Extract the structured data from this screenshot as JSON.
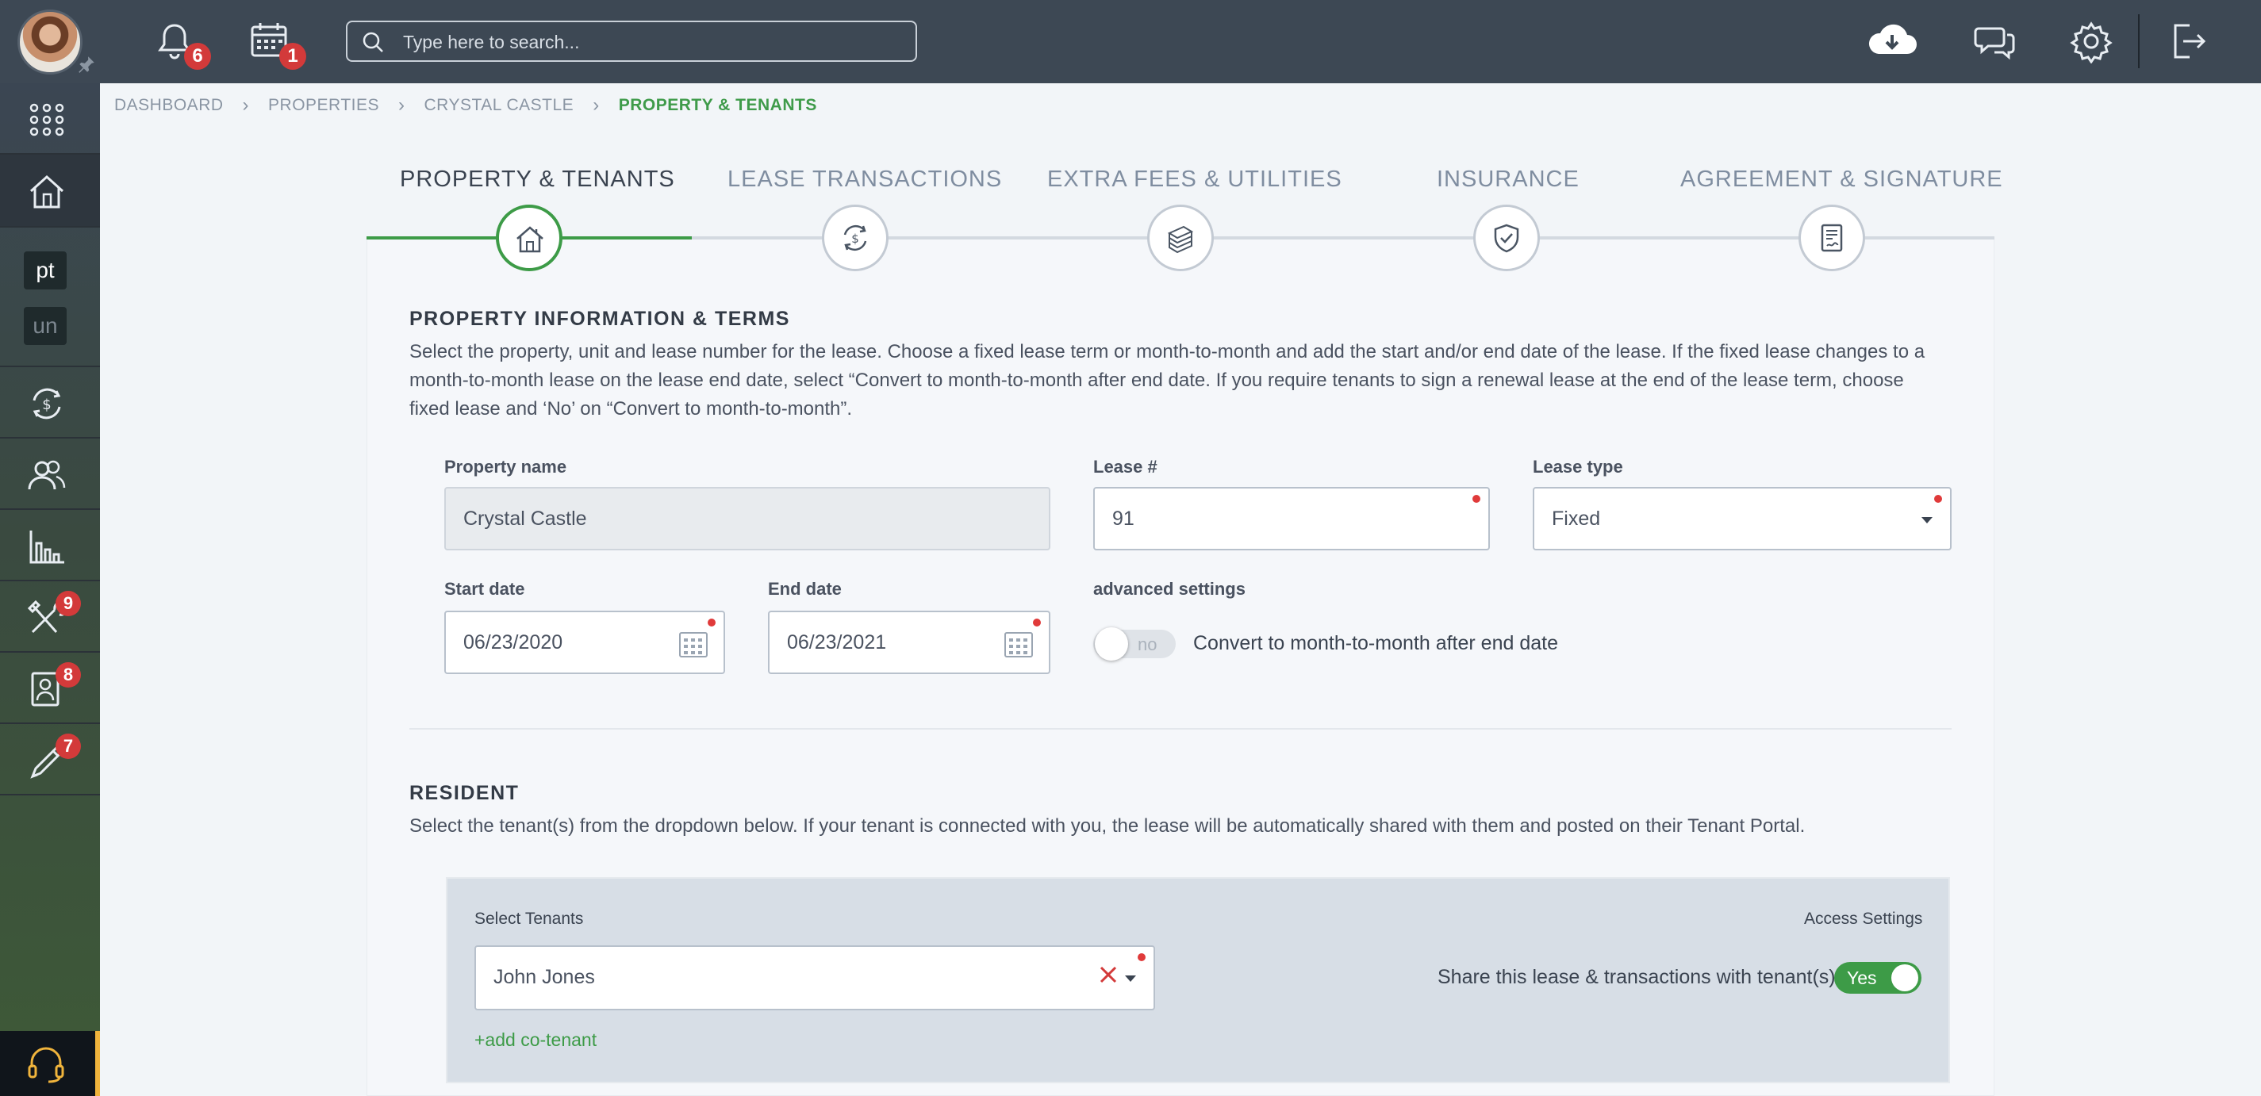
{
  "topbar": {
    "notifications_count": "6",
    "calendar_count": "1",
    "search_placeholder": "Type here to search..."
  },
  "sidebar": {
    "chip_pt": "pt",
    "chip_un": "un",
    "maintenance_badge": "9",
    "applicants_badge": "8",
    "tools_badge": "7"
  },
  "breadcrumb": {
    "items": [
      "DASHBOARD",
      "PROPERTIES",
      "CRYSTAL CASTLE"
    ],
    "current": "PROPERTY & TENANTS"
  },
  "stepper": {
    "steps": [
      {
        "label": "PROPERTY & TENANTS",
        "icon": "house-icon"
      },
      {
        "label": "LEASE TRANSACTIONS",
        "icon": "dollar-cycle-icon"
      },
      {
        "label": "EXTRA FEES & UTILITIES",
        "icon": "cash-stack-icon"
      },
      {
        "label": "INSURANCE",
        "icon": "shield-check-icon"
      },
      {
        "label": "AGREEMENT & SIGNATURE",
        "icon": "document-signature-icon"
      }
    ],
    "active_index": 0
  },
  "property_section": {
    "title": "PROPERTY INFORMATION & TERMS",
    "description": "Select the property, unit and lease number for the lease. Choose a fixed lease term or month-to-month and add the start and/or end date of the lease. If the fixed lease changes to a month-to-month lease on the lease end date, select “Convert to month-to-month after end date. If you require tenants to sign a renewal lease at the end of the lease term, choose fixed lease and ‘No’ on “Convert to month-to-month”.",
    "property_name_label": "Property name",
    "property_name_value": "Crystal Castle",
    "lease_number_label": "Lease #",
    "lease_number_value": "91",
    "lease_type_label": "Lease type",
    "lease_type_value": "Fixed",
    "start_date_label": "Start date",
    "start_date_value": "06/23/2020",
    "end_date_label": "End date",
    "end_date_value": "06/23/2021",
    "advanced_label": "advanced settings",
    "convert_toggle_text": "no",
    "convert_label": "Convert to month-to-month after end date"
  },
  "resident_section": {
    "title": "RESIDENT",
    "description": "Select the tenant(s) from the dropdown below. If your tenant is connected with you, the lease will be automatically shared with them and posted on their Tenant Portal.",
    "select_tenants_label": "Select Tenants",
    "tenant_value": "John Jones",
    "access_settings_label": "Access Settings",
    "share_label": "Share this lease & transactions with tenant(s)",
    "share_toggle_text": "Yes",
    "add_cotenant": "+add co-tenant"
  },
  "colors": {
    "topbar": "#3d4854",
    "accent_green": "#3d9b47",
    "badge_red": "#d33a3a",
    "required_dot": "#e03a3a"
  }
}
